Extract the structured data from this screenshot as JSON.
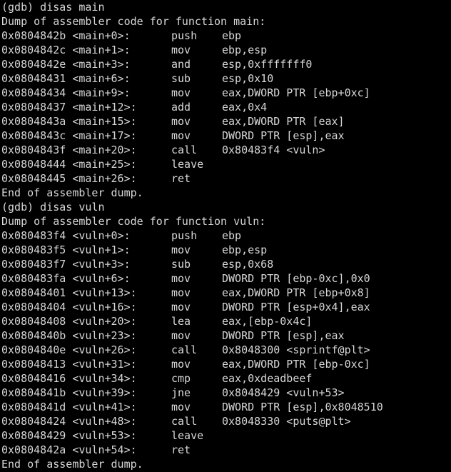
{
  "terminal": {
    "background_color": "#000000",
    "text_color": "#d6d6d6",
    "lines": [
      {
        "kind": "plain",
        "text": "(gdb) disas main"
      },
      {
        "kind": "plain",
        "text": "Dump of assembler code for function main:"
      },
      {
        "kind": "insn",
        "addr": "0x0804842b <main+0>:",
        "mnemonic": "push",
        "operands": "ebp"
      },
      {
        "kind": "insn",
        "addr": "0x0804842c <main+1>:",
        "mnemonic": "mov",
        "operands": "ebp,esp"
      },
      {
        "kind": "insn",
        "addr": "0x0804842e <main+3>:",
        "mnemonic": "and",
        "operands": "esp,0xfffffff0"
      },
      {
        "kind": "insn",
        "addr": "0x08048431 <main+6>:",
        "mnemonic": "sub",
        "operands": "esp,0x10"
      },
      {
        "kind": "insn",
        "addr": "0x08048434 <main+9>:",
        "mnemonic": "mov",
        "operands": "eax,DWORD PTR [ebp+0xc]"
      },
      {
        "kind": "insn",
        "addr": "0x08048437 <main+12>:",
        "mnemonic": "add",
        "operands": "eax,0x4"
      },
      {
        "kind": "insn",
        "addr": "0x0804843a <main+15>:",
        "mnemonic": "mov",
        "operands": "eax,DWORD PTR [eax]"
      },
      {
        "kind": "insn",
        "addr": "0x0804843c <main+17>:",
        "mnemonic": "mov",
        "operands": "DWORD PTR [esp],eax"
      },
      {
        "kind": "insn",
        "addr": "0x0804843f <main+20>:",
        "mnemonic": "call",
        "operands": "0x80483f4 <vuln>"
      },
      {
        "kind": "insn",
        "addr": "0x08048444 <main+25>:",
        "mnemonic": "leave",
        "operands": ""
      },
      {
        "kind": "insn",
        "addr": "0x08048445 <main+26>:",
        "mnemonic": "ret",
        "operands": ""
      },
      {
        "kind": "plain",
        "text": "End of assembler dump."
      },
      {
        "kind": "plain",
        "text": "(gdb) disas vuln"
      },
      {
        "kind": "plain",
        "text": "Dump of assembler code for function vuln:"
      },
      {
        "kind": "insn",
        "addr": "0x080483f4 <vuln+0>:",
        "mnemonic": "push",
        "operands": "ebp"
      },
      {
        "kind": "insn",
        "addr": "0x080483f5 <vuln+1>:",
        "mnemonic": "mov",
        "operands": "ebp,esp"
      },
      {
        "kind": "insn",
        "addr": "0x080483f7 <vuln+3>:",
        "mnemonic": "sub",
        "operands": "esp,0x68"
      },
      {
        "kind": "insn",
        "addr": "0x080483fa <vuln+6>:",
        "mnemonic": "mov",
        "operands": "DWORD PTR [ebp-0xc],0x0"
      },
      {
        "kind": "insn",
        "addr": "0x08048401 <vuln+13>:",
        "mnemonic": "mov",
        "operands": "eax,DWORD PTR [ebp+0x8]"
      },
      {
        "kind": "insn",
        "addr": "0x08048404 <vuln+16>:",
        "mnemonic": "mov",
        "operands": "DWORD PTR [esp+0x4],eax"
      },
      {
        "kind": "insn",
        "addr": "0x08048408 <vuln+20>:",
        "mnemonic": "lea",
        "operands": "eax,[ebp-0x4c]"
      },
      {
        "kind": "insn",
        "addr": "0x0804840b <vuln+23>:",
        "mnemonic": "mov",
        "operands": "DWORD PTR [esp],eax"
      },
      {
        "kind": "insn",
        "addr": "0x0804840e <vuln+26>:",
        "mnemonic": "call",
        "operands": "0x8048300 <sprintf@plt>"
      },
      {
        "kind": "insn",
        "addr": "0x08048413 <vuln+31>:",
        "mnemonic": "mov",
        "operands": "eax,DWORD PTR [ebp-0xc]"
      },
      {
        "kind": "insn",
        "addr": "0x08048416 <vuln+34>:",
        "mnemonic": "cmp",
        "operands": "eax,0xdeadbeef"
      },
      {
        "kind": "insn",
        "addr": "0x0804841b <vuln+39>:",
        "mnemonic": "jne",
        "operands": "0x8048429 <vuln+53>"
      },
      {
        "kind": "insn",
        "addr": "0x0804841d <vuln+41>:",
        "mnemonic": "mov",
        "operands": "DWORD PTR [esp],0x8048510"
      },
      {
        "kind": "insn",
        "addr": "0x08048424 <vuln+48>:",
        "mnemonic": "call",
        "operands": "0x8048330 <puts@plt>"
      },
      {
        "kind": "insn",
        "addr": "0x08048429 <vuln+53>:",
        "mnemonic": "leave",
        "operands": ""
      },
      {
        "kind": "insn",
        "addr": "0x0804842a <vuln+54>:",
        "mnemonic": "ret",
        "operands": ""
      },
      {
        "kind": "plain",
        "text": "End of assembler dump."
      }
    ]
  }
}
